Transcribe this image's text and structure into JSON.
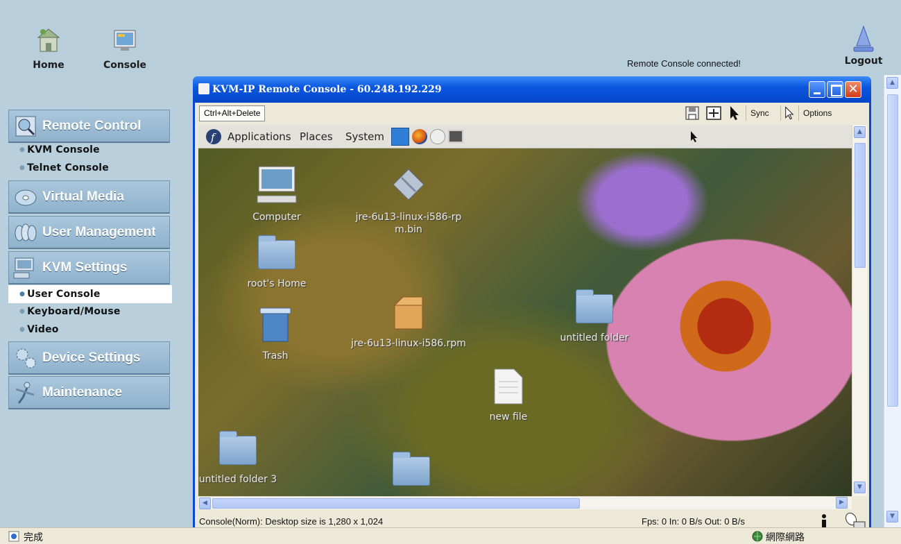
{
  "header": {
    "home_label": "Home",
    "console_label": "Console",
    "status_message": "Remote Console connected!",
    "logout_label": "Logout"
  },
  "sidebar": {
    "sections": [
      {
        "label": "Remote Control",
        "icon": "magnifier-icon"
      },
      {
        "label": "Virtual Media",
        "icon": "disc-icon"
      },
      {
        "label": "User Management",
        "icon": "users-icon"
      },
      {
        "label": "KVM Settings",
        "icon": "monitor-keyboard-icon"
      },
      {
        "label": "Device Settings",
        "icon": "gears-icon"
      },
      {
        "label": "Maintenance",
        "icon": "wrench-person-icon"
      }
    ],
    "remote_control_items": [
      "KVM Console",
      "Telnet Console"
    ],
    "kvm_settings_items": [
      "User Console",
      "Keyboard/Mouse",
      "Video"
    ],
    "active_item": "User Console"
  },
  "console_window": {
    "title": "KVM-IP Remote Console - 60.248.192.229",
    "ctrl_alt_delete": "Ctrl+Alt+Delete",
    "sync_label": "Sync",
    "options_label": "Options",
    "status_left": "Console(Norm): Desktop size is 1,280 x 1,024",
    "status_right": "Fps: 0 In: 0 B/s Out: 0 B/s",
    "colors": {
      "titlebar": "#0b58e0",
      "close": "#d13d1a"
    }
  },
  "remote_desktop": {
    "menus": [
      "Applications",
      "Places",
      "System"
    ],
    "icons": [
      {
        "label": "Computer",
        "type": "computer-icon"
      },
      {
        "label": "jre-6u13-linux-i586-rpm.bin",
        "type": "file-icon"
      },
      {
        "label": "root's Home",
        "type": "home-folder-icon"
      },
      {
        "label": "Trash",
        "type": "trash-icon"
      },
      {
        "label": "jre-6u13-linux-i586.rpm",
        "type": "package-icon"
      },
      {
        "label": "untitled folder",
        "type": "folder-icon"
      },
      {
        "label": "new file",
        "type": "document-icon"
      },
      {
        "label": "untitled folder 3",
        "type": "folder-icon"
      }
    ]
  },
  "browser_status": {
    "text": "完成",
    "zone": "網際網路"
  }
}
